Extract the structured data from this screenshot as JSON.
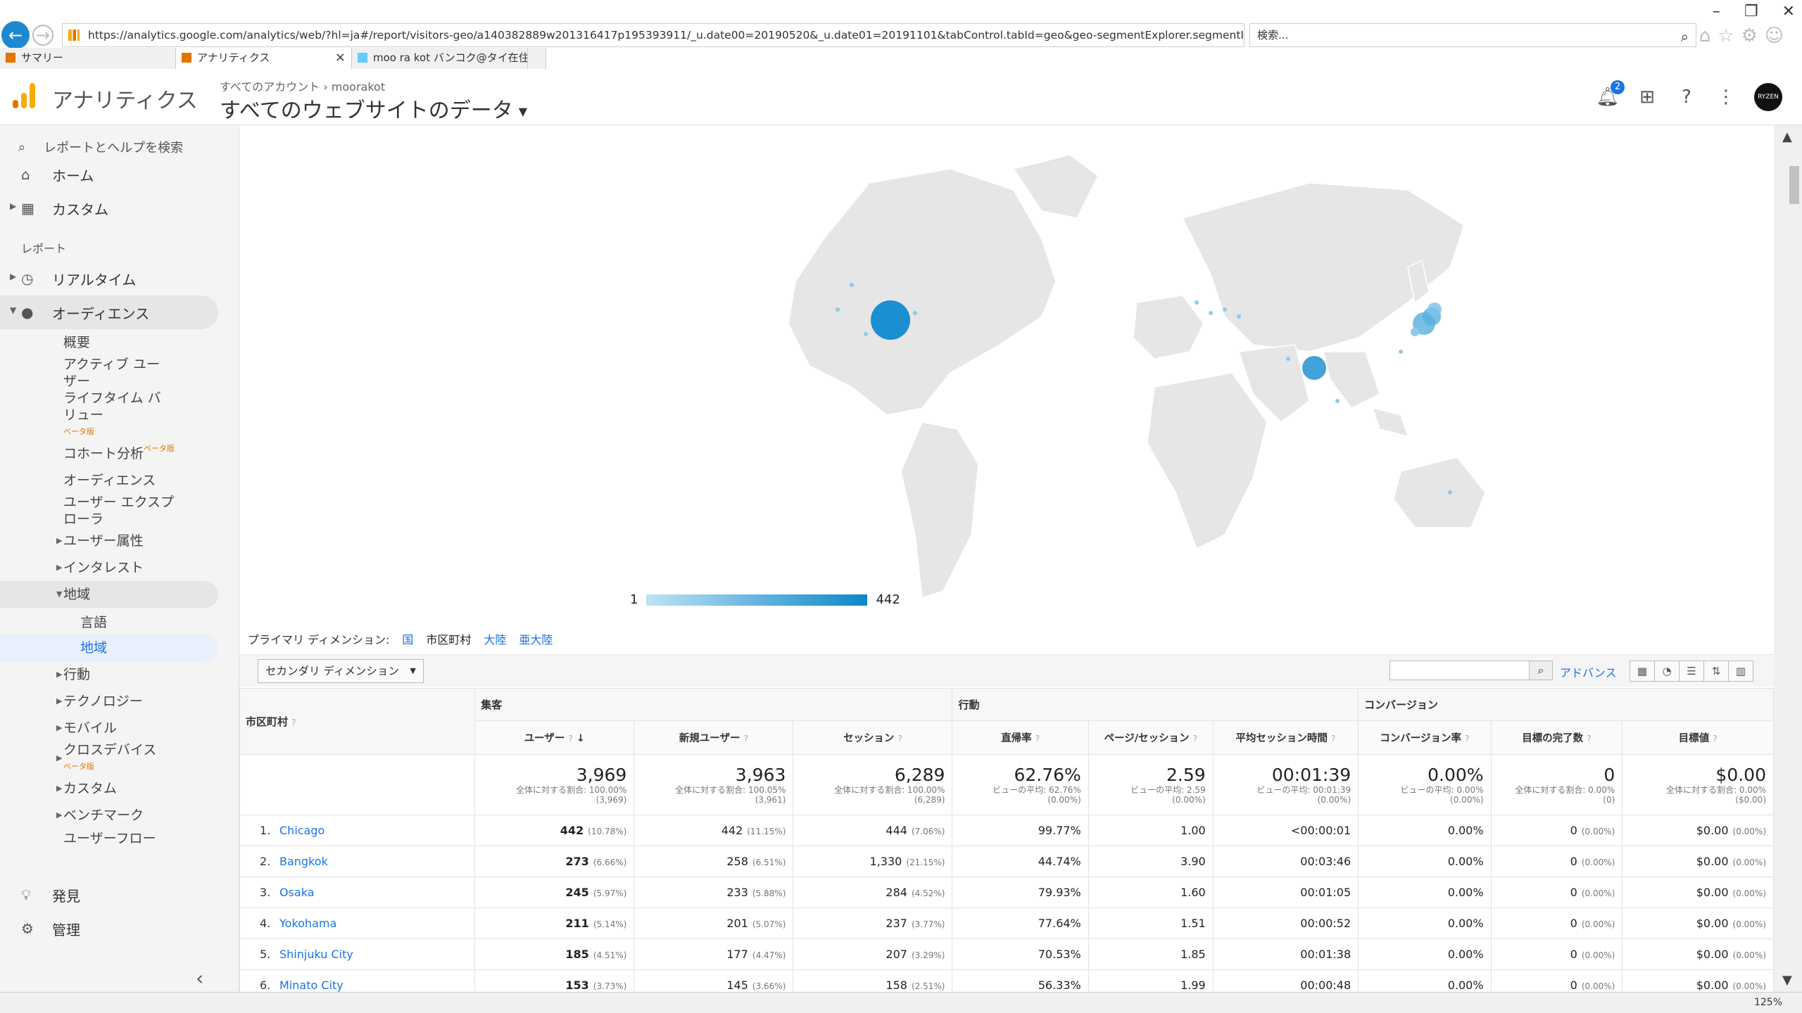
{
  "browser": {
    "url": "https://analytics.google.com/analytics/web/?hl=ja#/report/visitors-geo/a140382889w201316417p195393911/_u.date00=20190520&_u.date01=20191101&tabControl.tabId=geo&geo-segmentExplorer.segmentId=analytics.city&geo-table",
    "search_placeholder": "検索...",
    "tabs": [
      {
        "label": "サマリー"
      },
      {
        "label": "アナリティクス"
      },
      {
        "label": "moo ra kot バンコク@タイ在住／..."
      }
    ],
    "zoom": "125%"
  },
  "header": {
    "brand": "アナリティクス",
    "breadcrumb": "すべてのアカウント › moorakot",
    "property": "すべてのウェブサイトのデータ",
    "notif_count": "2",
    "avatar_text": "RYZEN"
  },
  "sidebar": {
    "search": "レポートとヘルプを検索",
    "home": "ホーム",
    "custom": "カスタム",
    "section_reports": "レポート",
    "realtime": "リアルタイム",
    "audience": "オーディエンス",
    "sub": {
      "overview": "概要",
      "active_users": "アクティブ ユーザー",
      "ltv": "ライフタイム バリュー",
      "beta": "ベータ版",
      "cohort": "コホート分析",
      "audiences": "オーディエンス",
      "user_explorer": "ユーザー エクスプローラ",
      "demographics": "ユーザー属性",
      "interests": "インタレスト",
      "geo": "地域",
      "language": "言語",
      "location": "地域",
      "behavior": "行動",
      "technology": "テクノロジー",
      "mobile": "モバイル",
      "cross_device": "クロスデバイス",
      "custom": "カスタム",
      "benchmark": "ベンチマーク",
      "user_flow": "ユーザーフロー"
    },
    "discover": "発見",
    "admin": "管理"
  },
  "map": {
    "legend_min": "1",
    "legend_max": "442"
  },
  "dimensions": {
    "label": "プライマリ ディメンション:",
    "country": "国",
    "city": "市区町村",
    "continent": "大陸",
    "subcontinent": "亜大陸"
  },
  "toolbar": {
    "secondary_dim": "セカンダリ ディメンション",
    "advanced": "アドバンス"
  },
  "table": {
    "groups": {
      "acq": "集客",
      "beh": "行動",
      "conv": "コンバージョン"
    },
    "dim_header": "市区町村",
    "headers": [
      "ユーザー",
      "新規ユーザー",
      "セッション",
      "直帰率",
      "ページ/セッション",
      "平均セッション時間",
      "コンバージョン率",
      "目標の完了数",
      "目標値"
    ],
    "totals": [
      {
        "v": "3,969",
        "s1": "全体に対する割合: 100.00%",
        "s2": "(3,969)"
      },
      {
        "v": "3,963",
        "s1": "全体に対する割合: 100.05%",
        "s2": "(3,961)"
      },
      {
        "v": "6,289",
        "s1": "全体に対する割合: 100.00%",
        "s2": "(6,289)"
      },
      {
        "v": "62.76%",
        "s1": "ビューの平均: 62.76%",
        "s2": "(0.00%)"
      },
      {
        "v": "2.59",
        "s1": "ビューの平均: 2.59",
        "s2": "(0.00%)"
      },
      {
        "v": "00:01:39",
        "s1": "ビューの平均: 00:01:39",
        "s2": "(0.00%)"
      },
      {
        "v": "0.00%",
        "s1": "ビューの平均: 0.00%",
        "s2": "(0.00%)"
      },
      {
        "v": "0",
        "s1": "全体に対する割合: 0.00%",
        "s2": "(0)"
      },
      {
        "v": "$0.00",
        "s1": "全体に対する割合: 0.00%",
        "s2": "($0.00)"
      }
    ],
    "rows": [
      {
        "n": "1.",
        "city": "Chicago",
        "users": "442",
        "users_p": "(10.78%)",
        "new": "442",
        "new_p": "(11.15%)",
        "sess": "444",
        "sess_p": "(7.06%)",
        "bounce": "99.77%",
        "pps": "1.00",
        "dur": "<00:00:01",
        "cr": "0.00%",
        "goals": "0",
        "goals_p": "(0.00%)",
        "val": "$0.00",
        "val_p": "(0.00%)"
      },
      {
        "n": "2.",
        "city": "Bangkok",
        "users": "273",
        "users_p": "(6.66%)",
        "new": "258",
        "new_p": "(6.51%)",
        "sess": "1,330",
        "sess_p": "(21.15%)",
        "bounce": "44.74%",
        "pps": "3.90",
        "dur": "00:03:46",
        "cr": "0.00%",
        "goals": "0",
        "goals_p": "(0.00%)",
        "val": "$0.00",
        "val_p": "(0.00%)"
      },
      {
        "n": "3.",
        "city": "Osaka",
        "users": "245",
        "users_p": "(5.97%)",
        "new": "233",
        "new_p": "(5.88%)",
        "sess": "284",
        "sess_p": "(4.52%)",
        "bounce": "79.93%",
        "pps": "1.60",
        "dur": "00:01:05",
        "cr": "0.00%",
        "goals": "0",
        "goals_p": "(0.00%)",
        "val": "$0.00",
        "val_p": "(0.00%)"
      },
      {
        "n": "4.",
        "city": "Yokohama",
        "users": "211",
        "users_p": "(5.14%)",
        "new": "201",
        "new_p": "(5.07%)",
        "sess": "237",
        "sess_p": "(3.77%)",
        "bounce": "77.64%",
        "pps": "1.51",
        "dur": "00:00:52",
        "cr": "0.00%",
        "goals": "0",
        "goals_p": "(0.00%)",
        "val": "$0.00",
        "val_p": "(0.00%)"
      },
      {
        "n": "5.",
        "city": "Shinjuku City",
        "users": "185",
        "users_p": "(4.51%)",
        "new": "177",
        "new_p": "(4.47%)",
        "sess": "207",
        "sess_p": "(3.29%)",
        "bounce": "70.53%",
        "pps": "1.85",
        "dur": "00:01:38",
        "cr": "0.00%",
        "goals": "0",
        "goals_p": "(0.00%)",
        "val": "$0.00",
        "val_p": "(0.00%)"
      },
      {
        "n": "6.",
        "city": "Minato City",
        "users": "153",
        "users_p": "(3.73%)",
        "new": "145",
        "new_p": "(3.66%)",
        "sess": "158",
        "sess_p": "(2.51%)",
        "bounce": "56.33%",
        "pps": "1.99",
        "dur": "00:00:48",
        "cr": "0.00%",
        "goals": "0",
        "goals_p": "(0.00%)",
        "val": "$0.00",
        "val_p": "(0.00%)"
      }
    ]
  },
  "colors": {
    "accent": "#1a73e8",
    "map_bubble": "#1a8fd1",
    "land": "#e8e8e8"
  }
}
